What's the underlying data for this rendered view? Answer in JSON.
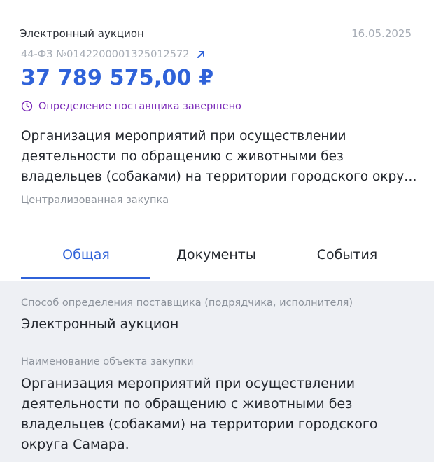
{
  "procurement": {
    "type": "Электронный аукцион",
    "date": "16.05.2025",
    "number": "44-ФЗ №0142200001325012572",
    "price": "37 789 575,00 ₽",
    "status": "Определение поставщика завершено",
    "title": "Организация мероприятий при осуществлении деятельности по обращению с животными без владельцев (собаками) на территории городского округа Самара.",
    "tag": "Централизованная закупка"
  },
  "tabs": [
    {
      "label": "Общая",
      "active": true
    },
    {
      "label": "Документы",
      "active": false
    },
    {
      "label": "События",
      "active": false
    }
  ],
  "details": {
    "method_label": "Способ определения поставщика (подрядчика, исполнителя)",
    "method_value": "Электронный аукцион",
    "object_label": "Наименование объекта закупки",
    "object_value": "Организация мероприятий при осуществлении деятельности по обращению с животными без владельцев (собаками) на территории городского округа Самара."
  },
  "colors": {
    "accent": "#2f62d9",
    "status": "#7b2bb9",
    "muted": "#a6acb5",
    "panel_bg": "#eef0f4"
  },
  "icons": {
    "number_link": "arrow-up-right-icon",
    "status": "clock-icon"
  }
}
